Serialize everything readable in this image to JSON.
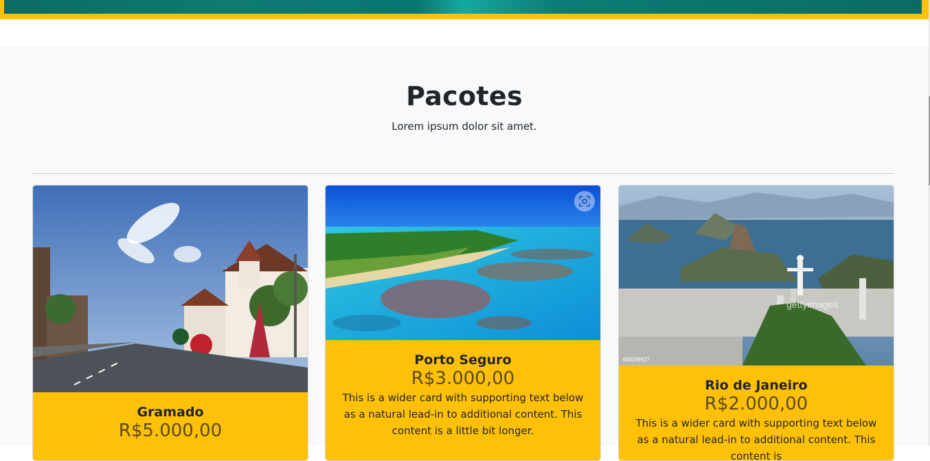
{
  "section": {
    "title": "Pacotes",
    "subtitle": "Lorem ipsum dolor sit amet."
  },
  "cards": [
    {
      "title": "Gramado",
      "price": "R$5.000,00",
      "text": ""
    },
    {
      "title": "Porto Seguro",
      "price": "R$3.000,00",
      "text": "This is a wider card with supporting text below as a natural lead-in to additional content. This content is a little bit longer."
    },
    {
      "title": "Rio de Janeiro",
      "price": "R$2.000,00",
      "text": "This is a wider card with supporting text below as a natural lead-in to additional content. This content is"
    }
  ],
  "watermark": {
    "brand": "gettyimages",
    "image_id": "458296627"
  },
  "colors": {
    "card_body": "#ffc107",
    "section_bg": "#f8f9fa",
    "hero_teal": "#0b6b66"
  }
}
